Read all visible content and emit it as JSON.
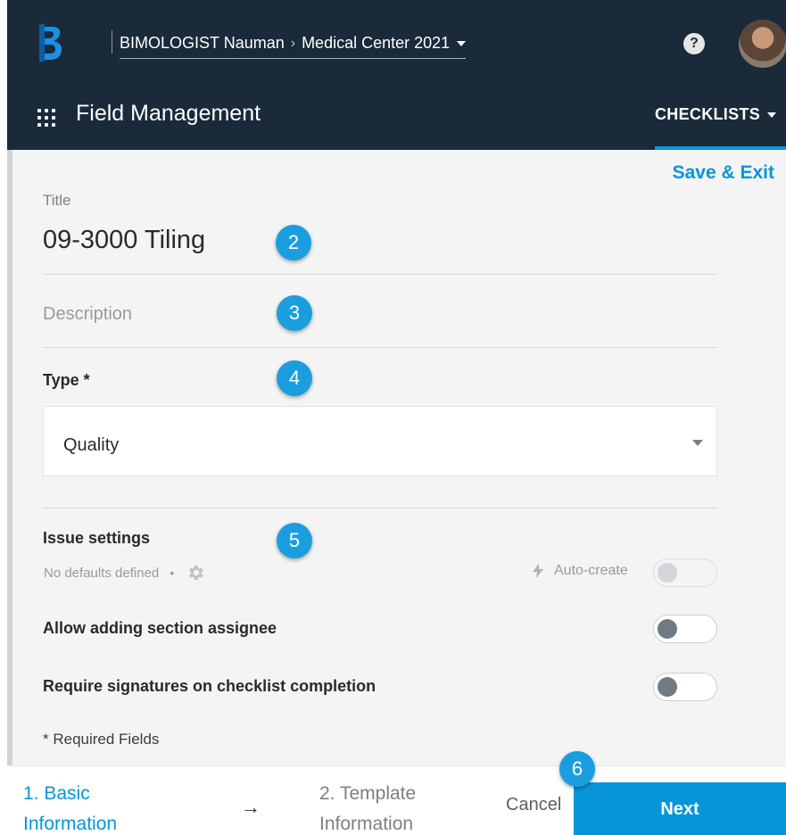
{
  "header": {
    "breadcrumb_account": "BIMOLOGIST Nauman",
    "breadcrumb_separator": "›",
    "breadcrumb_project": "Medical Center 2021",
    "help_label": "?"
  },
  "subheader": {
    "module_title": "Field Management",
    "menu_label": "CHECKLISTS"
  },
  "form": {
    "save_exit_label": "Save & Exit",
    "title_label": "Title",
    "title_value": "09-3000 Tiling",
    "description_placeholder": "Description",
    "type_label": "Type *",
    "type_value": "Quality",
    "issue_settings_label": "Issue settings",
    "no_defaults_text": "No defaults defined",
    "bullet": "•",
    "auto_create_label": "Auto-create",
    "auto_create_enabled": false,
    "allow_assignee_label": "Allow adding section assignee",
    "allow_assignee_on": false,
    "require_signatures_label": "Require signatures on checklist completion",
    "require_signatures_on": false,
    "required_note": "* Required Fields"
  },
  "badges": [
    "2",
    "3",
    "4",
    "5",
    "6"
  ],
  "footer": {
    "step1_line1": "1. Basic",
    "step1_line2": "Information",
    "arrow": "→",
    "step2_line1": "2. Template",
    "step2_line2": "Information",
    "cancel_label": "Cancel",
    "next_label": "Next"
  },
  "colors": {
    "header_bg": "#1a2a3a",
    "accent": "#0696d7",
    "badge": "#1b9ee0",
    "content_bg": "#f4f4f4"
  }
}
